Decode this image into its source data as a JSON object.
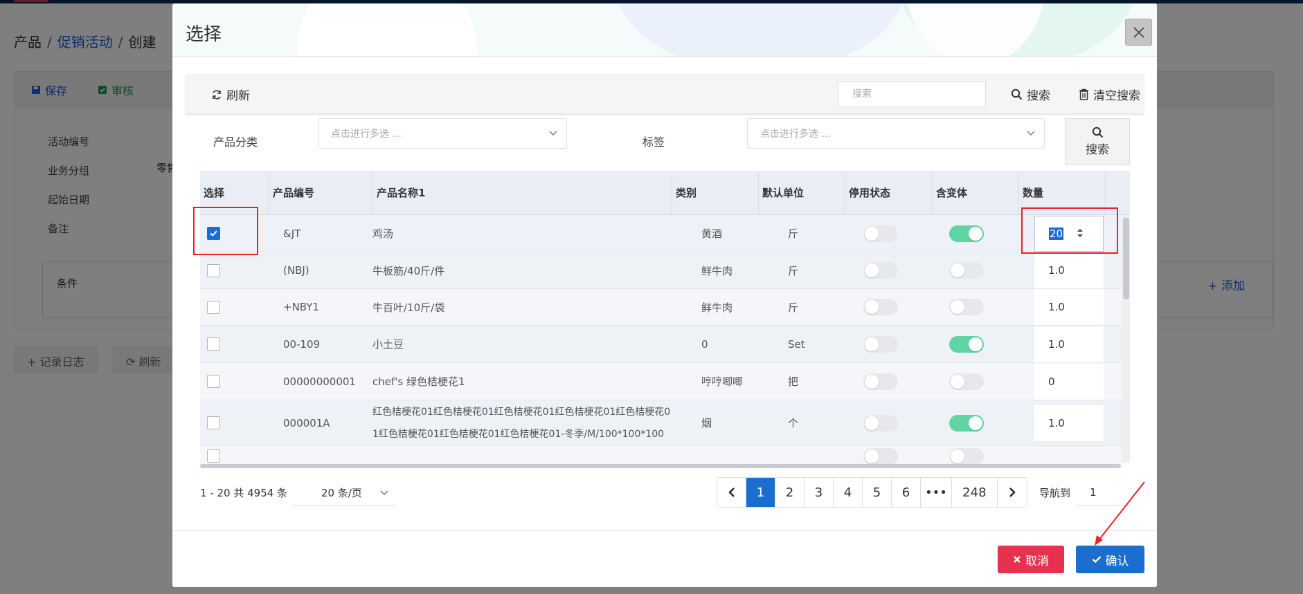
{
  "background": {
    "breadcrumb": {
      "root": "产品",
      "link": "促销活动",
      "current": "创建",
      "sep": "/"
    },
    "toolbar": {
      "save": "保存",
      "review": "审核"
    },
    "form_labels": {
      "code": "活动编号",
      "group": "业务分组",
      "start_date": "起始日期",
      "remark": "备注"
    },
    "group_value": "零售",
    "condition_title": "条件",
    "add_label": "添加",
    "log_button": "记录日志",
    "refresh_button": "刷新"
  },
  "modal": {
    "title": "选择",
    "toolbar": {
      "refresh": "刷新",
      "search_placeholder": "搜索",
      "search": "搜索",
      "clear_search": "清空搜索"
    },
    "filters": {
      "category_label": "产品分类",
      "category_placeholder": "点击进行多选 ...",
      "tag_label": "标签",
      "tag_placeholder": "点击进行多选 ...",
      "search_button": "搜索"
    },
    "table": {
      "columns": [
        "选择",
        "产品编号",
        "产品名称1",
        "类别",
        "默认单位",
        "停用状态",
        "含变体",
        "数量"
      ],
      "rows": [
        {
          "selected": true,
          "code": "&JT",
          "name": "鸡汤",
          "category": "黄酒",
          "unit": "斤",
          "disabled": false,
          "has_variant": true,
          "qty": "20"
        },
        {
          "selected": false,
          "code": "(NBJ)",
          "name": "牛板筋/40斤/件",
          "category": "鲜牛肉",
          "unit": "斤",
          "disabled": false,
          "has_variant": false,
          "qty": "1.0"
        },
        {
          "selected": false,
          "code": "+NBY1",
          "name": "牛百叶/10斤/袋",
          "category": "鲜牛肉",
          "unit": "斤",
          "disabled": false,
          "has_variant": false,
          "qty": "1.0"
        },
        {
          "selected": false,
          "code": "00-109",
          "name": "小土豆",
          "category": "0",
          "unit": "Set",
          "disabled": false,
          "has_variant": true,
          "qty": "1.0"
        },
        {
          "selected": false,
          "code": "00000000001",
          "name": "chef's 绿色桔梗花1",
          "category": "哼哼唧唧",
          "unit": "把",
          "disabled": false,
          "has_variant": false,
          "qty": "0"
        },
        {
          "selected": false,
          "code": "000001A",
          "name_line1": "红色桔梗花01红色桔梗花01红色桔梗花01红色桔梗花01红色桔梗花0",
          "name_line2": "1红色桔梗花01红色桔梗花01红色桔梗花01-冬季/M/100*100*100",
          "category": "烟",
          "unit": "个",
          "disabled": false,
          "has_variant": true,
          "qty": "1.0"
        }
      ]
    },
    "pagination": {
      "info": "1 - 20 共 4954 条",
      "page_size": "20 条/页",
      "pages": [
        "1",
        "2",
        "3",
        "4",
        "5",
        "6",
        "•••",
        "248"
      ],
      "active_page": "1",
      "goto_label": "导航到",
      "goto_value": "1"
    },
    "footer": {
      "cancel": "取消",
      "confirm": "确认"
    }
  },
  "colors": {
    "primary": "#1c6dd0",
    "danger": "#e8304f",
    "toggle_on": "#5ed5a2",
    "annotation_red": "#e8222a"
  }
}
